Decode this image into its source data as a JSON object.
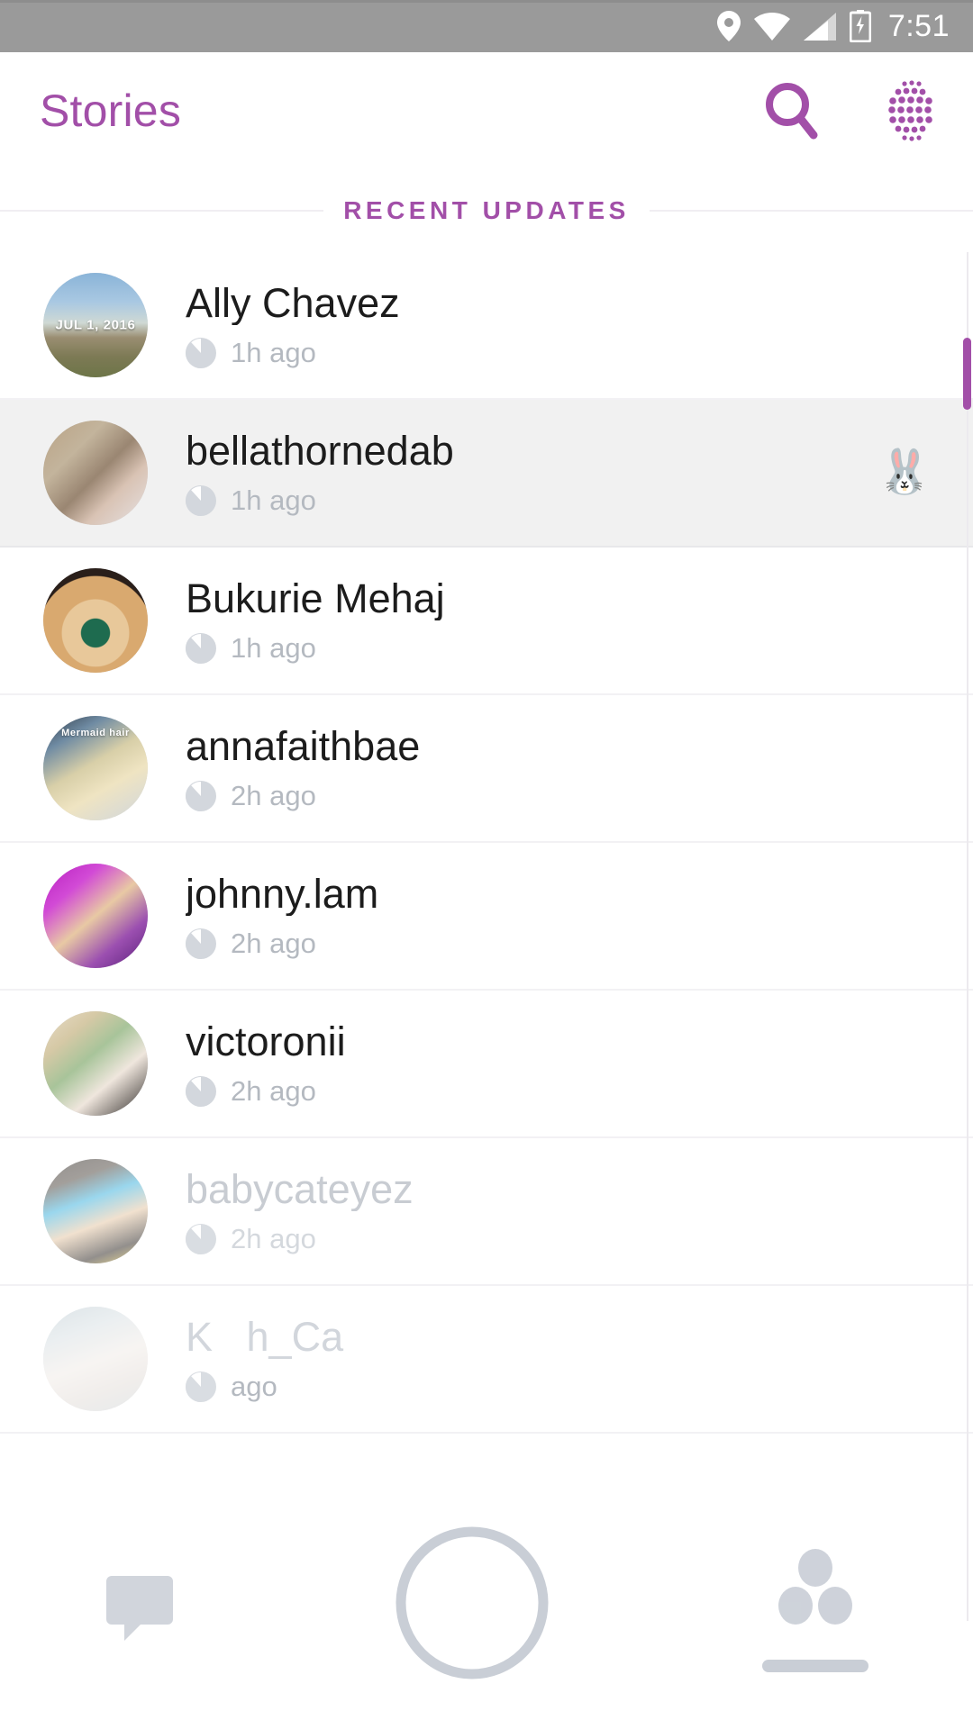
{
  "statusbar": {
    "time": "7:51",
    "icons": [
      "location-icon",
      "wifi-icon",
      "cellular-signal-icon",
      "battery-charging-icon"
    ],
    "background_color": "#9a9a9a"
  },
  "header": {
    "title": "Stories",
    "accent_color": "#a24fa8",
    "search_icon": "search-icon",
    "ghost_menu_icon": "dotted-grid-icon"
  },
  "section": {
    "label": "RECENT UPDATES"
  },
  "stories": [
    {
      "name": "Ally Chavez",
      "time": "1h ago",
      "avatar_caption": "JUL 1, 2016",
      "avatar_kind": "landscape-sky",
      "viewed": false,
      "selected": false,
      "emoji": ""
    },
    {
      "name": "bellathornedab",
      "time": "1h ago",
      "avatar_caption": "",
      "avatar_kind": "portrait-woman",
      "viewed": false,
      "selected": true,
      "emoji": "🐰"
    },
    {
      "name": "Bukurie Mehaj",
      "time": "1h ago",
      "avatar_caption": "",
      "avatar_kind": "starbucks-cup",
      "viewed": false,
      "selected": false,
      "emoji": ""
    },
    {
      "name": "annafaithbae",
      "time": "2h ago",
      "avatar_caption": "Mermaid hair",
      "avatar_kind": "blonde-hair",
      "viewed": false,
      "selected": false,
      "emoji": ""
    },
    {
      "name": "johnny.lam",
      "time": "2h ago",
      "avatar_caption": "",
      "avatar_kind": "magenta-portrait",
      "viewed": false,
      "selected": false,
      "emoji": ""
    },
    {
      "name": "victoronii",
      "time": "2h ago",
      "avatar_caption": "",
      "avatar_kind": "money-selfie",
      "viewed": false,
      "selected": false,
      "emoji": ""
    },
    {
      "name": "babycateyez",
      "time": "2h ago",
      "avatar_caption": "",
      "avatar_kind": "phone-mirror-selfie",
      "viewed": true,
      "selected": false,
      "emoji": ""
    },
    {
      "name": "K   h_Ca",
      "time": "ago",
      "avatar_caption": "",
      "avatar_kind": "car-selfie",
      "viewed": true,
      "selected": false,
      "emoji": ""
    }
  ],
  "bottom_nav": {
    "chat_icon": "chat-bubble-icon",
    "capture_icon": "camera-capture-button",
    "friends_icon": "friends-icon"
  },
  "scrollbar": {
    "thumb_color": "#a24fa8"
  }
}
